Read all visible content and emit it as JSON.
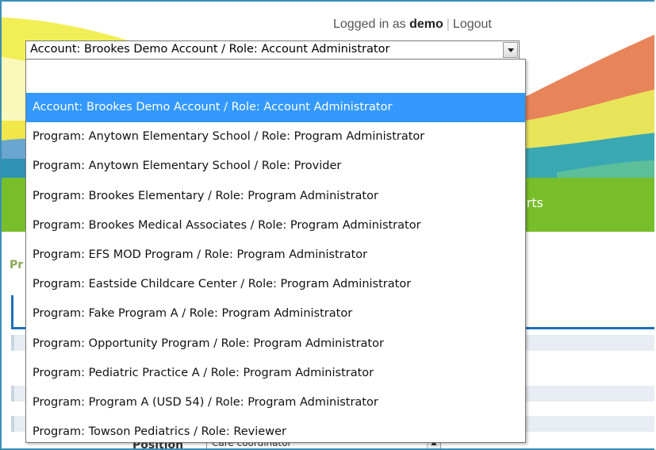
{
  "header": {
    "logged_in_prefix": "Logged in as",
    "username": "demo",
    "separator": "|",
    "logout_label": "Logout"
  },
  "account_select": {
    "selected": "Account: Brookes Demo Account / Role: Account Administrator",
    "search_value": "",
    "options": [
      "Account: Brookes Demo Account / Role: Account Administrator",
      "Program: Anytown Elementary School / Role: Program Administrator",
      "Program: Anytown Elementary School / Role: Provider",
      "Program: Brookes Elementary / Role: Program Administrator",
      "Program: Brookes Medical Associates / Role: Program Administrator",
      "Program: EFS MOD Program / Role: Program Administrator",
      "Program: Eastside Childcare Center / Role: Program Administrator",
      "Program: Fake Program A / Role: Program Administrator",
      "Program: Opportunity Program / Role: Program Administrator",
      "Program: Pediatric Practice A / Role: Program Administrator",
      "Program: Program A (USD 54) / Role: Program Administrator",
      "Program: Towson Pediatrics / Role: Reviewer"
    ],
    "highlighted_index": 0
  },
  "nav": {
    "partial_item": "orts"
  },
  "page": {
    "partial_heading": "Pr",
    "position_label": "Position",
    "position_value": "Care coordinator"
  },
  "colors": {
    "nav_green": "#78be2a",
    "highlight_blue": "#3399ff",
    "frame_blue": "#3a8fb7"
  }
}
